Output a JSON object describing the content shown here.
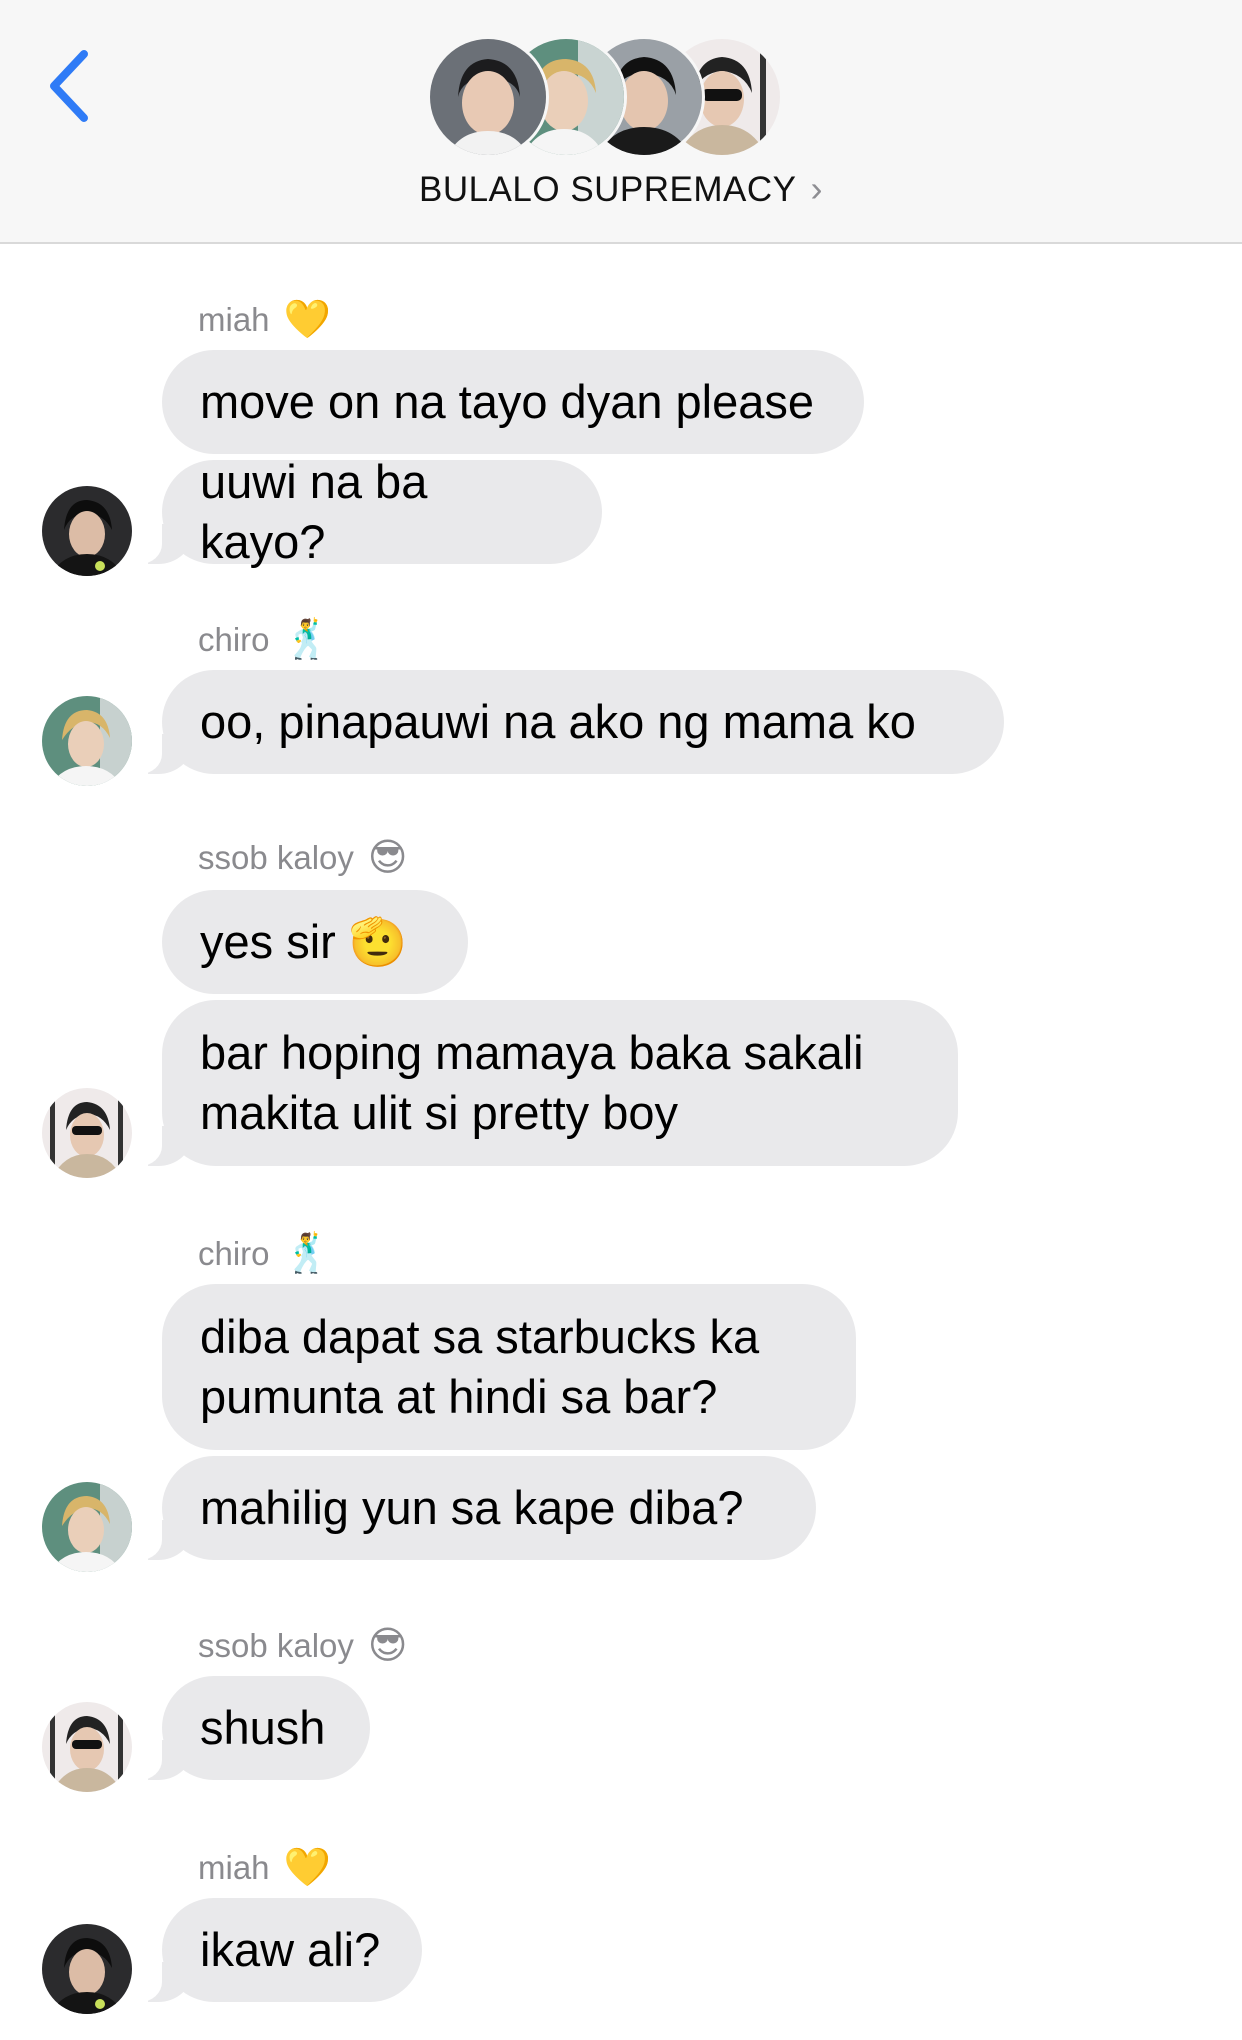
{
  "header": {
    "back_icon": "chevron-left-icon",
    "group_title": "BULALO SUPREMACY",
    "title_chevron": "›",
    "accent_color": "#2f7bf6"
  },
  "messages": [
    {
      "sender": "miah",
      "sender_emoji": "💛",
      "bubbles": [
        "move on na tayo dyan please",
        "uuwi na ba kayo?"
      ]
    },
    {
      "sender": "chiro",
      "sender_emoji": "🕺",
      "bubbles": [
        "oo, pinapauwi na ako ng mama ko"
      ]
    },
    {
      "sender": "ssob kaloy",
      "sender_emoji": "😎",
      "bubbles": [
        "yes sir 🫡",
        "bar hoping mamaya baka sakali\nmakita ulit si pretty boy"
      ]
    },
    {
      "sender": "chiro",
      "sender_emoji": "🕺",
      "bubbles": [
        "diba dapat sa starbucks ka\npumunta at hindi sa bar?",
        "mahilig yun sa kape diba?"
      ]
    },
    {
      "sender": "ssob kaloy",
      "sender_emoji": "😎",
      "bubbles": [
        "shush"
      ]
    },
    {
      "sender": "miah",
      "sender_emoji": "💛",
      "bubbles": [
        "ikaw ali?"
      ]
    }
  ],
  "colors": {
    "bubble_incoming": "#e9e9eb",
    "sender_name": "#8a8a8e",
    "header_bg": "#f7f7f7"
  }
}
